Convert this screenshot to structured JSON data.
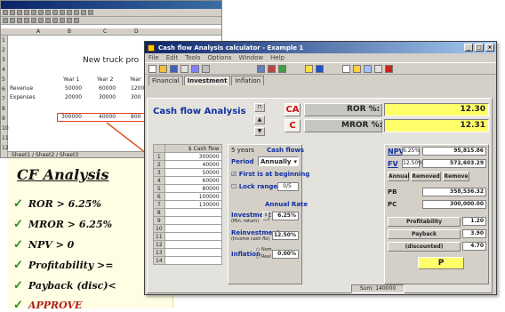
{
  "spreadsheet": {
    "columns": [
      "A",
      "B",
      "C",
      "D"
    ],
    "rows": [
      "1",
      "2",
      "3",
      "4",
      "5",
      "6",
      "7",
      "8",
      "9",
      "10",
      "11",
      "12"
    ],
    "title": "New truck pro",
    "year_headers": [
      "Year 1",
      "Year 2",
      "Year"
    ],
    "revenue_label": "Revenue",
    "revenue_values": [
      "50000",
      "60000",
      "1200"
    ],
    "expenses_label": "Expenses",
    "expenses_values": [
      "20000",
      "30000",
      "300"
    ],
    "selected_values": [
      "300000",
      "40000",
      "800"
    ],
    "sheet_tabs": "Sheet1 / Sheet2 / Sheet3"
  },
  "note": {
    "heading": "CF Analysis",
    "items": [
      "ROR > 6.25%",
      "MROR > 6.25%",
      "NPV > 0",
      "Profitability >=",
      "Payback (disc)<",
      "APPROVE"
    ]
  },
  "app": {
    "title": "Cash flow Analysis calculator - Example 1",
    "menu": [
      "File",
      "Edit",
      "Tools",
      "Options",
      "Window",
      "Help"
    ],
    "tabs": [
      "Financial",
      "Investment",
      "Inflation"
    ],
    "panel_title": "Cash flow Analysis",
    "ca_label": "CA",
    "c_label": "C",
    "ror_label": "ROR %:",
    "ror_value": "12.30",
    "mror_label": "MROR %:",
    "mror_value": "12.31",
    "table_header": "$ Cash flow",
    "cash_flows": [
      "300000",
      "40000",
      "50000",
      "60000",
      "80000",
      "100000",
      "130000",
      "",
      "",
      "",
      "",
      "",
      "",
      ""
    ],
    "row_numbers": [
      "1",
      "2",
      "3",
      "4",
      "5",
      "6",
      "7",
      "8",
      "9",
      "10",
      "11",
      "12",
      "13",
      "14"
    ],
    "periods": "5 years",
    "cash_flows_label": "Cash flows",
    "period_label": "Period",
    "period_value": "Annually",
    "first_at_beginning": "First is at beginning",
    "lock_range": "Lock range",
    "lock_range_value": "0/5",
    "annual_rate_label": "Annual Rate",
    "investment_label": "Investment",
    "investment_sub": "(Min. return)",
    "investment_rate": "6.25%",
    "reinvestment_label": "Reinvestment",
    "reinvestment_sub": "(Income cash flo)",
    "reinvestment_rate": "12.50%",
    "inflation_label": "Inflation",
    "inflation_opt1": "Nom",
    "inflation_opt2": "Real",
    "inflation_rate": "0.00%",
    "npv_label": "NPV",
    "npv_rate": "6.25%",
    "npv_value": "95,815.86",
    "fv_label": "FV",
    "fv_rate": "12.50%",
    "fv_value": "572,603.29",
    "annual_btn": "Annual",
    "removed_btn": "Removed",
    "remove_btn": "Remove",
    "pb_label": "PB",
    "pb_value": "358,536.32",
    "pc_label": "PC",
    "pc_value": "300,000.00",
    "profitability_label": "Profitability",
    "profitability_value": "1.20",
    "payback_label": "Payback",
    "payback_value": "3.90",
    "discounted_label": "(discounted)",
    "discounted_value": "4.70",
    "status_sum": "Sum: 140000"
  }
}
